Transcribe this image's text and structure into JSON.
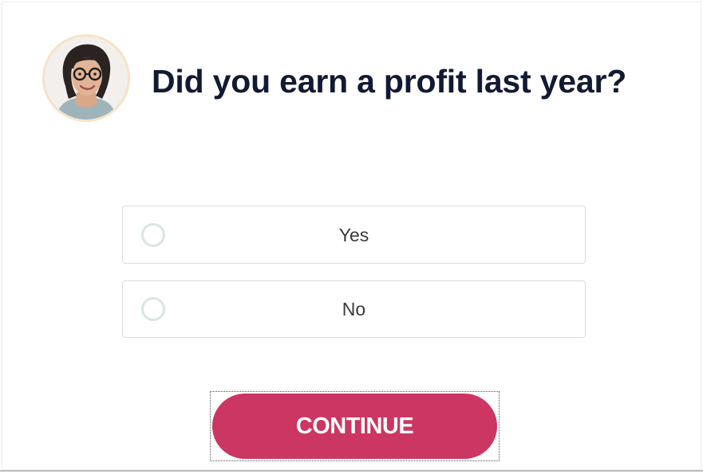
{
  "question": {
    "title": "Did you earn a profit last year?",
    "avatar_icon": "person-avatar-icon"
  },
  "options": [
    {
      "label": "Yes",
      "selected": false
    },
    {
      "label": "No",
      "selected": false
    }
  ],
  "continue": {
    "label": "CONTINUE",
    "color": "#cb3662"
  },
  "colors": {
    "title_text": "#121a33",
    "option_border": "#dcdcdc",
    "radio_border": "#d9e6e2",
    "avatar_ring": "#f7e2c8"
  }
}
